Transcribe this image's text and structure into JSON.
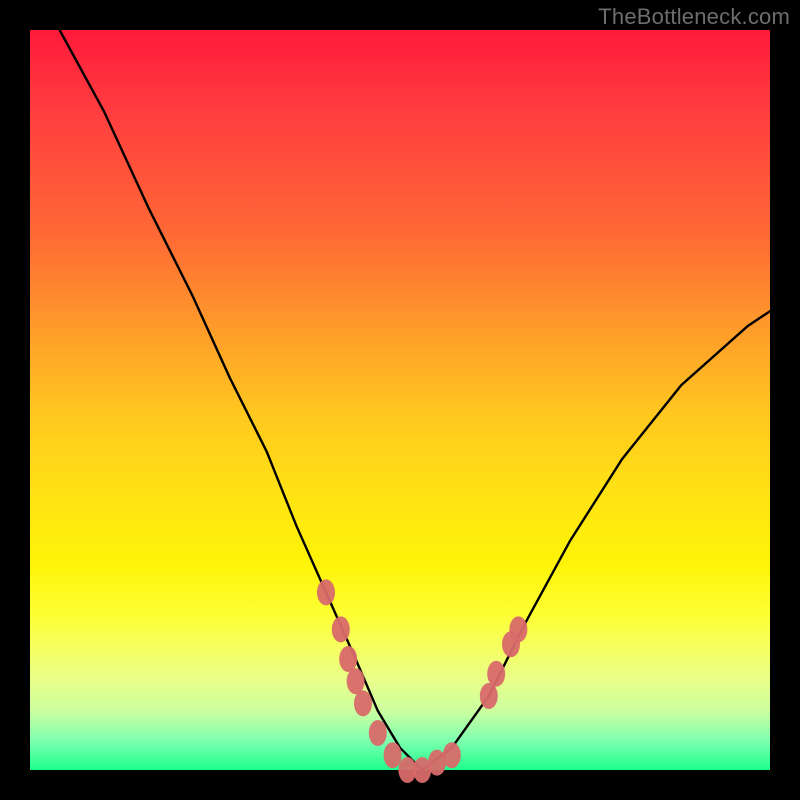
{
  "watermark": "TheBottleneck.com",
  "chart_data": {
    "type": "line",
    "title": "",
    "xlabel": "",
    "ylabel": "",
    "xlim": [
      0,
      100
    ],
    "ylim": [
      0,
      100
    ],
    "grid": false,
    "legend": false,
    "background_gradient": {
      "stops": [
        {
          "pos": 0,
          "color": "#ff1a3a"
        },
        {
          "pos": 28,
          "color": "#ff6a35"
        },
        {
          "pos": 52,
          "color": "#ffc81f"
        },
        {
          "pos": 72,
          "color": "#fff408"
        },
        {
          "pos": 92,
          "color": "#ccffa0"
        },
        {
          "pos": 100,
          "color": "#1cff8c"
        }
      ]
    },
    "series": [
      {
        "name": "bottleneck-curve",
        "x": [
          4,
          10,
          16,
          22,
          27,
          32,
          36,
          40,
          44,
          47,
          50,
          53,
          57,
          62,
          67,
          73,
          80,
          88,
          97,
          100
        ],
        "y": [
          100,
          89,
          76,
          64,
          53,
          43,
          33,
          24,
          15,
          8,
          3,
          0,
          3,
          10,
          20,
          31,
          42,
          52,
          60,
          62
        ]
      }
    ],
    "markers": {
      "name": "highlight-dots",
      "color": "#d86a6a",
      "points": [
        {
          "x": 40,
          "y": 24
        },
        {
          "x": 42,
          "y": 19
        },
        {
          "x": 43,
          "y": 15
        },
        {
          "x": 44,
          "y": 12
        },
        {
          "x": 45,
          "y": 9
        },
        {
          "x": 47,
          "y": 5
        },
        {
          "x": 49,
          "y": 2
        },
        {
          "x": 51,
          "y": 0
        },
        {
          "x": 53,
          "y": 0
        },
        {
          "x": 55,
          "y": 1
        },
        {
          "x": 57,
          "y": 2
        },
        {
          "x": 62,
          "y": 10
        },
        {
          "x": 63,
          "y": 13
        },
        {
          "x": 65,
          "y": 17
        },
        {
          "x": 66,
          "y": 19
        }
      ]
    }
  }
}
